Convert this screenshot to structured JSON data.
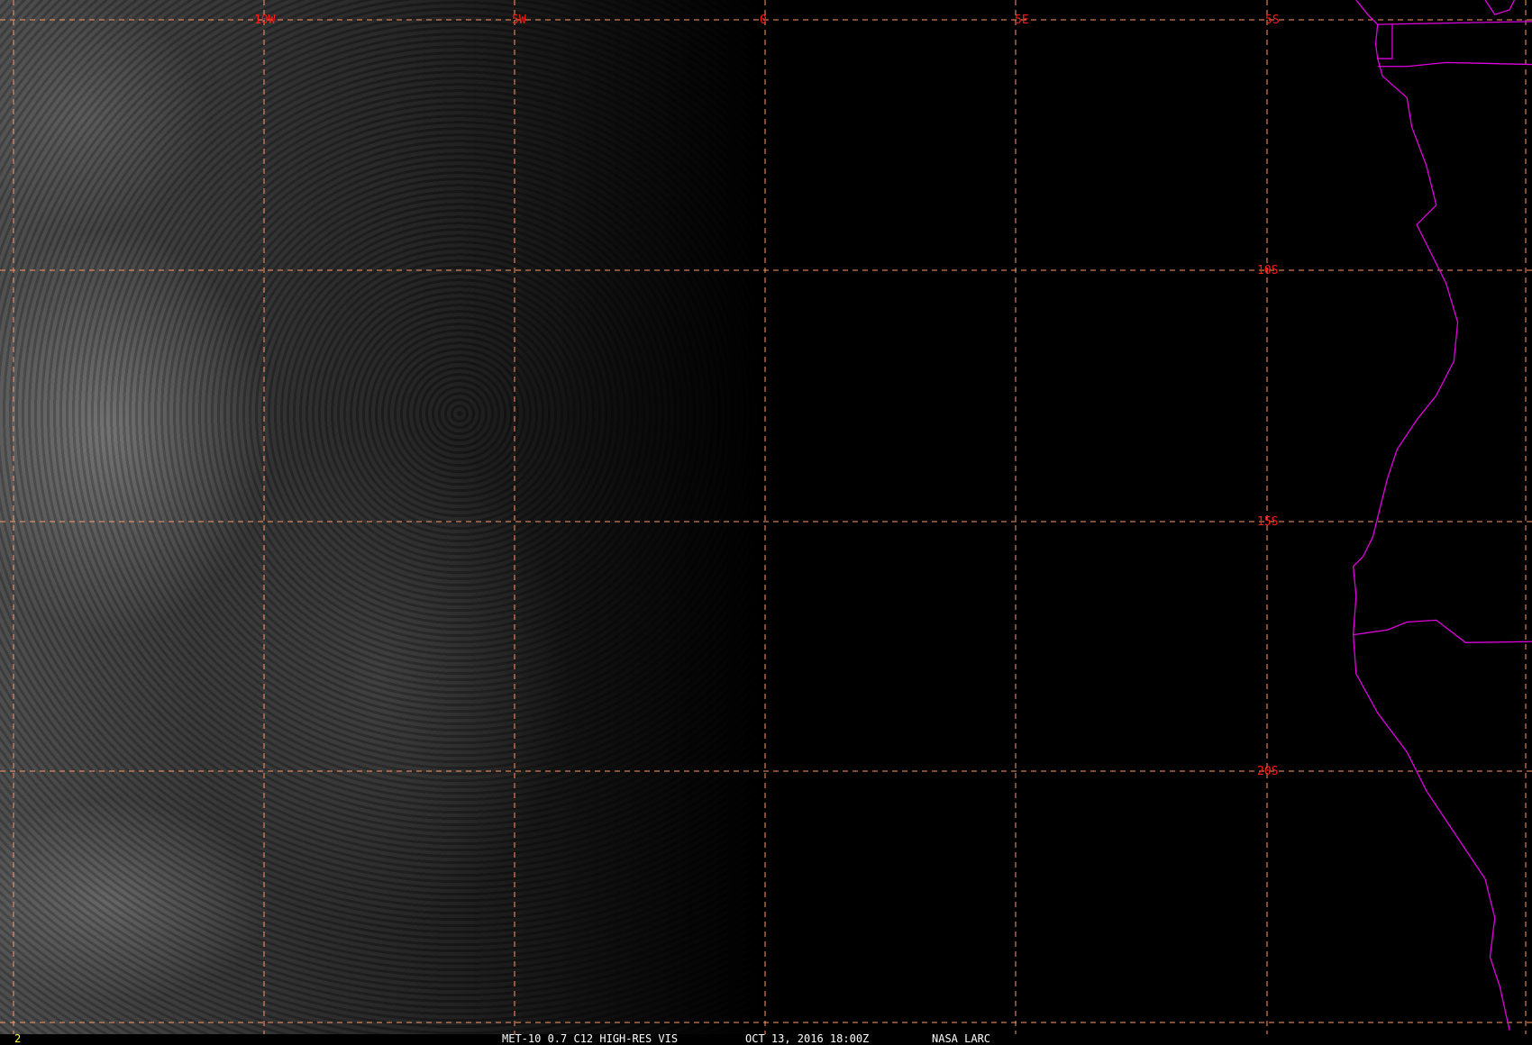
{
  "grid": {
    "lon_labels": [
      "10W",
      "5W",
      "0",
      "5E"
    ],
    "lat_labels": [
      "5S",
      "10S",
      "15S",
      "20S"
    ],
    "line_color": "#ff9966",
    "label_color": "#ff1a1a"
  },
  "coastline_color": "#e000e0",
  "caption": {
    "frame_number": "2",
    "product": "MET-10 0.7 C12 HIGH-RES VIS",
    "datetime": "OCT 13, 2016 18:00Z",
    "source": "NASA LARC"
  }
}
